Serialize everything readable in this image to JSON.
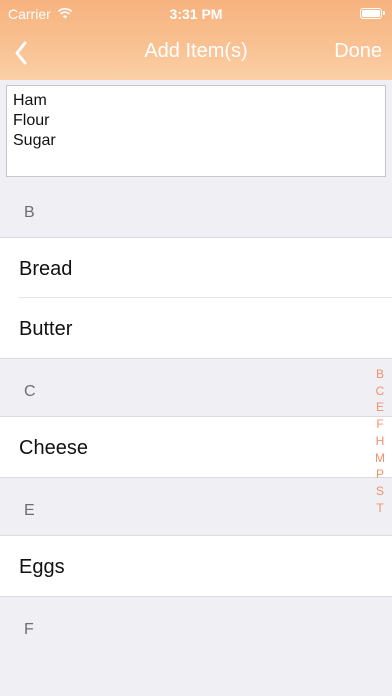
{
  "status_bar": {
    "carrier": "Carrier",
    "time": "3:31 PM"
  },
  "nav": {
    "title": "Add Item(s)",
    "done_label": "Done"
  },
  "text_input": {
    "lines": [
      "Ham",
      "Flour",
      "Sugar"
    ]
  },
  "sections": [
    {
      "header": "B",
      "items": [
        "Bread",
        "Butter"
      ]
    },
    {
      "header": "C",
      "items": [
        "Cheese"
      ]
    },
    {
      "header": "E",
      "items": [
        "Eggs"
      ]
    },
    {
      "header": "F",
      "items": []
    }
  ],
  "index_letters": [
    "B",
    "C",
    "E",
    "F",
    "H",
    "M",
    "P",
    "S",
    "T"
  ],
  "colors": {
    "accent": "#f2916b",
    "header_top": "#f6b27f",
    "header_bottom": "#fbd0a6"
  },
  "icons": {
    "back": "chevron-left-icon",
    "wifi": "wifi-icon",
    "battery": "battery-icon"
  }
}
